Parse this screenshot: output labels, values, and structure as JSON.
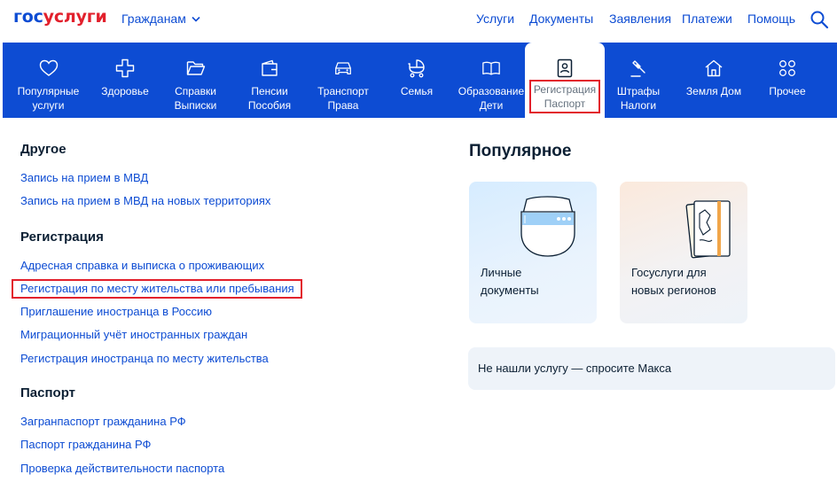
{
  "header": {
    "logo_part1": "гос",
    "logo_part2": "услуги",
    "audience_label": "Гражданам",
    "nav": [
      "Услуги",
      "Документы",
      "Заявления",
      "Платежи",
      "Помощь"
    ]
  },
  "categories": [
    {
      "line1": "Популярные",
      "line2": "услуги",
      "icon": "heart-icon"
    },
    {
      "line1": "Здоровье",
      "line2": "",
      "icon": "health-cross-icon"
    },
    {
      "line1": "Справки",
      "line2": "Выписки",
      "icon": "folder-icon"
    },
    {
      "line1": "Пенсии",
      "line2": "Пособия",
      "icon": "wallet-icon"
    },
    {
      "line1": "Транспорт",
      "line2": "Права",
      "icon": "car-icon"
    },
    {
      "line1": "Семья",
      "line2": "",
      "icon": "stroller-icon"
    },
    {
      "line1": "Образование",
      "line2": "Дети",
      "icon": "book-icon"
    },
    {
      "line1": "Регистрация",
      "line2": "Паспорт",
      "icon": "passport-icon"
    },
    {
      "line1": "Штрафы",
      "line2": "Налоги",
      "icon": "gavel-icon"
    },
    {
      "line1": "Земля Дом",
      "line2": "",
      "icon": "house-icon"
    },
    {
      "line1": "Прочее",
      "line2": "",
      "icon": "grid-icon"
    }
  ],
  "sections": [
    {
      "title": "Другое",
      "links": [
        "Запись на прием в МВД",
        "Запись на прием в МВД на новых территориях"
      ]
    },
    {
      "title": "Регистрация",
      "links": [
        "Адресная справка и выписка о проживающих",
        "Регистрация по месту жительства или пребывания",
        "Приглашение иностранца в Россию",
        "Миграционный учёт иностранных граждан",
        "Регистрация иностранца по месту жительства"
      ]
    },
    {
      "title": "Паспорт",
      "links": [
        "Загранпаспорт гражданина РФ",
        "Паспорт гражданина РФ",
        "Проверка действительности паспорта"
      ]
    }
  ],
  "popular": {
    "title": "Популярное",
    "cards": [
      {
        "line1": "Личные",
        "line2": "документы"
      },
      {
        "line1": "Госуслуги для",
        "line2": "новых регионов"
      }
    ],
    "ask": "Не нашли услугу — спросите Макса"
  },
  "colors": {
    "brand_blue": "#0d4cd3",
    "brand_red": "#e2202c",
    "text_dark": "#0b1f33"
  }
}
